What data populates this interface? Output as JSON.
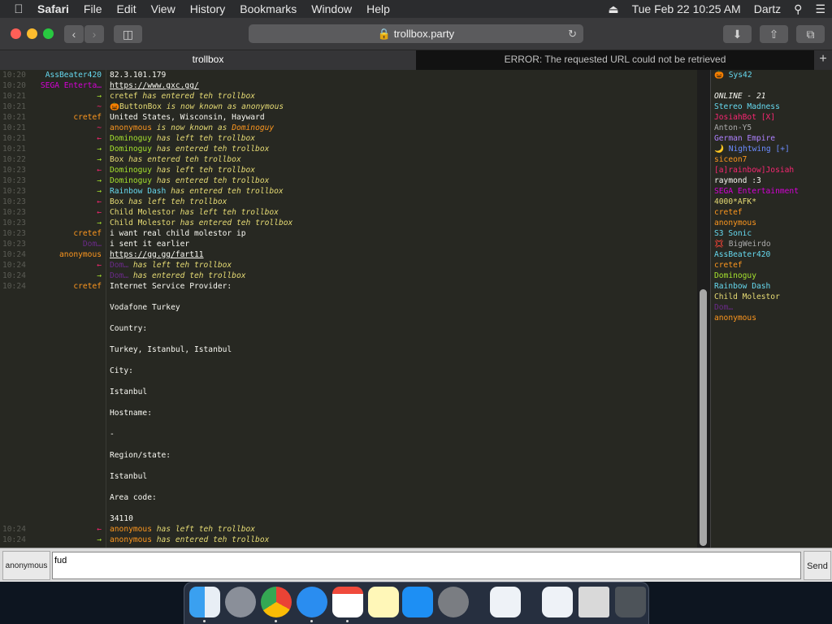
{
  "menubar": {
    "app": "Safari",
    "items": [
      "File",
      "Edit",
      "View",
      "History",
      "Bookmarks",
      "Window",
      "Help"
    ],
    "clock": "Tue Feb 22  10:25 AM",
    "user": "Dartz"
  },
  "toolbar": {
    "url": "trollbox.party"
  },
  "tabs": {
    "active": "trollbox",
    "other": "ERROR: The requested URL could not be retrieved"
  },
  "colors": {
    "bg": "#272822",
    "green": "#a6e22e",
    "red": "#f92672",
    "yellow": "#e6db74",
    "cyan": "#66d9ef"
  },
  "chat": {
    "rows": [
      {
        "ts": "10:20",
        "nick": "AssBeater420",
        "nc": "#66d9ef",
        "msg": "82.3.101.179",
        "type": "msg"
      },
      {
        "ts": "10:20",
        "nick": "SEGA Enterta…",
        "nc": "#d600d6",
        "msg": "https://www.gxc.gg/",
        "type": "link"
      },
      {
        "ts": "10:21",
        "nick": "→",
        "nc": "#a6e22e",
        "name": "cretef",
        "namec": "#e6db74",
        "msg": " has entered teh trollbox",
        "type": "act"
      },
      {
        "ts": "10:21",
        "nick": "~",
        "nc": "#f92672",
        "name": "🎃ButtonBox",
        "namec": "#e6db74",
        "msg": " is now known as ",
        "name2": "anonymous",
        "type": "act"
      },
      {
        "ts": "10:21",
        "nick": "cretef",
        "nc": "#fd971f",
        "msg": "United States, Wisconsin, Hayward",
        "type": "msg"
      },
      {
        "ts": "10:21",
        "nick": "~",
        "nc": "#f92672",
        "name": "anonymous",
        "namec": "#fd971f",
        "msg": " is now known as ",
        "name2": "Dominoguy",
        "type": "act"
      },
      {
        "ts": "10:21",
        "nick": "←",
        "nc": "#f92672",
        "name": "Dominoguy",
        "namec": "#a6e22e",
        "msg": " has left teh trollbox",
        "type": "act"
      },
      {
        "ts": "10:21",
        "nick": "→",
        "nc": "#a6e22e",
        "name": "Dominoguy",
        "namec": "#a6e22e",
        "msg": " has entered teh trollbox",
        "type": "act"
      },
      {
        "ts": "10:22",
        "nick": "→",
        "nc": "#a6e22e",
        "name": "Box",
        "namec": "#e6db74",
        "msg": " has entered teh trollbox",
        "type": "act"
      },
      {
        "ts": "10:23",
        "nick": "←",
        "nc": "#f92672",
        "name": "Dominoguy",
        "namec": "#a6e22e",
        "msg": " has left teh trollbox",
        "type": "act"
      },
      {
        "ts": "10:23",
        "nick": "→",
        "nc": "#a6e22e",
        "name": "Dominoguy",
        "namec": "#a6e22e",
        "msg": " has entered teh trollbox",
        "type": "act"
      },
      {
        "ts": "10:23",
        "nick": "→",
        "nc": "#a6e22e",
        "name": "Rainbow Dash",
        "namec": "#66d9ef",
        "msg": " has entered teh trollbox",
        "type": "act"
      },
      {
        "ts": "10:23",
        "nick": "←",
        "nc": "#f92672",
        "name": "Box",
        "namec": "#e6db74",
        "msg": " has left teh trollbox",
        "type": "act"
      },
      {
        "ts": "10:23",
        "nick": "←",
        "nc": "#f92672",
        "name": "Child Molestor",
        "namec": "#e6db74",
        "msg": " has left teh trollbox",
        "type": "act"
      },
      {
        "ts": "10:23",
        "nick": "→",
        "nc": "#a6e22e",
        "name": "Child Molestor",
        "namec": "#e6db74",
        "msg": " has entered teh trollbox",
        "type": "act"
      },
      {
        "ts": "10:23",
        "nick": "cretef",
        "nc": "#fd971f",
        "msg": "i want real child molestor ip",
        "type": "msg"
      },
      {
        "ts": "10:23",
        "nick": "Dom…",
        "nc": "#6b2a8a",
        "msg": "i sent it earlier",
        "type": "msg"
      },
      {
        "ts": "10:24",
        "nick": "anonymous",
        "nc": "#fd971f",
        "msg": "https://gg.gg/fart11",
        "type": "link"
      },
      {
        "ts": "10:24",
        "nick": "←",
        "nc": "#f92672",
        "name": "Dom…",
        "namec": "#6b2a8a",
        "msg": " has left teh trollbox",
        "type": "act"
      },
      {
        "ts": "10:24",
        "nick": "→",
        "nc": "#a6e22e",
        "name": "Dom…",
        "namec": "#6b2a8a",
        "msg": " has entered teh trollbox",
        "type": "act"
      },
      {
        "ts": "10:24",
        "nick": "cretef",
        "nc": "#fd971f",
        "msg": "Internet Service Provider:",
        "type": "msg"
      },
      {
        "ts": "",
        "nick": "",
        "nc": "",
        "msg": "",
        "type": "msg"
      },
      {
        "ts": "",
        "nick": "",
        "nc": "",
        "msg": "Vodafone Turkey",
        "type": "msg"
      },
      {
        "ts": "",
        "nick": "",
        "nc": "",
        "msg": "",
        "type": "msg"
      },
      {
        "ts": "",
        "nick": "",
        "nc": "",
        "msg": "Country:",
        "type": "msg"
      },
      {
        "ts": "",
        "nick": "",
        "nc": "",
        "msg": "",
        "type": "msg"
      },
      {
        "ts": "",
        "nick": "",
        "nc": "",
        "msg": "Turkey, Istanbul, Istanbul",
        "type": "msg"
      },
      {
        "ts": "",
        "nick": "",
        "nc": "",
        "msg": "",
        "type": "msg"
      },
      {
        "ts": "",
        "nick": "",
        "nc": "",
        "msg": "City:",
        "type": "msg"
      },
      {
        "ts": "",
        "nick": "",
        "nc": "",
        "msg": "",
        "type": "msg"
      },
      {
        "ts": "",
        "nick": "",
        "nc": "",
        "msg": "Istanbul",
        "type": "msg"
      },
      {
        "ts": "",
        "nick": "",
        "nc": "",
        "msg": "",
        "type": "msg"
      },
      {
        "ts": "",
        "nick": "",
        "nc": "",
        "msg": "Hostname:",
        "type": "msg"
      },
      {
        "ts": "",
        "nick": "",
        "nc": "",
        "msg": "",
        "type": "msg"
      },
      {
        "ts": "",
        "nick": "",
        "nc": "",
        "msg": "-",
        "type": "msg"
      },
      {
        "ts": "",
        "nick": "",
        "nc": "",
        "msg": "",
        "type": "msg"
      },
      {
        "ts": "",
        "nick": "",
        "nc": "",
        "msg": "Region/state:",
        "type": "msg"
      },
      {
        "ts": "",
        "nick": "",
        "nc": "",
        "msg": "",
        "type": "msg"
      },
      {
        "ts": "",
        "nick": "",
        "nc": "",
        "msg": "Istanbul",
        "type": "msg"
      },
      {
        "ts": "",
        "nick": "",
        "nc": "",
        "msg": "",
        "type": "msg"
      },
      {
        "ts": "",
        "nick": "",
        "nc": "",
        "msg": "Area code:",
        "type": "msg"
      },
      {
        "ts": "",
        "nick": "",
        "nc": "",
        "msg": "",
        "type": "msg"
      },
      {
        "ts": "",
        "nick": "",
        "nc": "",
        "msg": "34110",
        "type": "msg"
      },
      {
        "ts": "10:24",
        "nick": "←",
        "nc": "#f92672",
        "name": "anonymous",
        "namec": "#fd971f",
        "msg": " has left teh trollbox",
        "type": "act"
      },
      {
        "ts": "10:24",
        "nick": "→",
        "nc": "#a6e22e",
        "name": "anonymous",
        "namec": "#fd971f",
        "msg": " has entered teh trollbox",
        "type": "act"
      }
    ]
  },
  "users": {
    "list": [
      {
        "name": "🎃 Sys42",
        "c": "#66d9ef"
      },
      {
        "name": "",
        "c": "#fff"
      },
      {
        "name": "ONLINE - 21",
        "c": "#f8f8f2",
        "italic": true
      },
      {
        "name": "Stereo Madness",
        "c": "#66d9ef"
      },
      {
        "name": "JosiahBot [X]",
        "c": "#f92672"
      },
      {
        "name": "Anton-Y5",
        "c": "#aaaaaa"
      },
      {
        "name": "German Empire",
        "c": "#ae81ff"
      },
      {
        "name": "🌙 Nightwing [+]",
        "c": "#6c8cff"
      },
      {
        "name": "siceon7",
        "c": "#fd971f"
      },
      {
        "name": "[a]rainbow]Josiah",
        "c": "#f92672"
      },
      {
        "name": "raymond :3",
        "c": "#f8f8f2"
      },
      {
        "name": "SEGA Entertainment",
        "c": "#d600d6"
      },
      {
        "name": "4000*AFK*",
        "c": "#e6db74"
      },
      {
        "name": "cretef",
        "c": "#fd971f"
      },
      {
        "name": "anonymous",
        "c": "#fd971f"
      },
      {
        "name": "S3 Sonic",
        "c": "#66d9ef"
      },
      {
        "name": "💢 BigWeirdo",
        "c": "#aaaaaa"
      },
      {
        "name": "AssBeater420",
        "c": "#66d9ef"
      },
      {
        "name": "cretef",
        "c": "#fd971f"
      },
      {
        "name": "Dominoguy",
        "c": "#a6e22e"
      },
      {
        "name": "Rainbow Dash",
        "c": "#66d9ef"
      },
      {
        "name": "Child Molestor",
        "c": "#e6db74"
      },
      {
        "name": "Dom…",
        "c": "#6b2a8a"
      },
      {
        "name": "anonymous",
        "c": "#fd971f"
      }
    ]
  },
  "input": {
    "nick": "anonymous",
    "value": "fud",
    "send": "Send"
  }
}
